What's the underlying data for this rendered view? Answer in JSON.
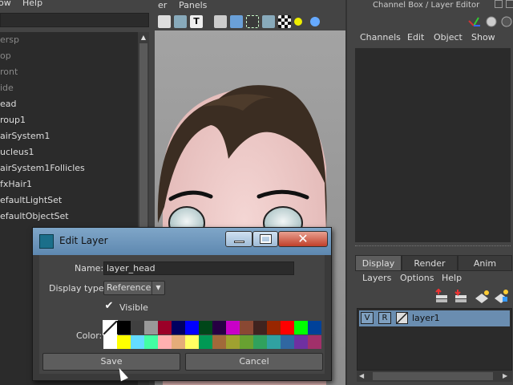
{
  "outliner": {
    "menu": [
      "ow",
      "Help"
    ],
    "items": [
      {
        "label": "ersp",
        "dim": true
      },
      {
        "label": "op",
        "dim": true
      },
      {
        "label": "ront",
        "dim": true
      },
      {
        "label": "ide",
        "dim": true
      },
      {
        "label": "ead",
        "dim": false
      },
      {
        "label": "roup1",
        "dim": false
      },
      {
        "label": "airSystem1",
        "dim": false
      },
      {
        "label": "ucleus1",
        "dim": false
      },
      {
        "label": "airSystem1Follicles",
        "dim": false
      },
      {
        "label": "fxHair1",
        "dim": false
      },
      {
        "label": "efaultLightSet",
        "dim": false
      },
      {
        "label": "efaultObjectSet",
        "dim": false
      }
    ]
  },
  "viewport": {
    "menu": [
      "er",
      "Panels"
    ]
  },
  "channel_box": {
    "title": "Channel Box / Layer Editor",
    "menu": [
      "Channels",
      "Edit",
      "Object",
      "Show"
    ],
    "tabs": [
      "Display",
      "Render",
      "Anim"
    ],
    "active_tab": "Display",
    "layer_menu": [
      "Layers",
      "Options",
      "Help"
    ],
    "layers": [
      {
        "visible_btn": "V",
        "ref_btn": "R",
        "name": "layer1"
      }
    ]
  },
  "dialog": {
    "title": "Edit Layer",
    "name_label": "Name:",
    "name_value": "layer_head",
    "display_type_label": "Display type:",
    "display_type_value": "Reference",
    "visible_label": "Visible",
    "visible_checked": true,
    "color_label": "Color:",
    "save_label": "Save",
    "cancel_label": "Cancel",
    "palette": [
      "#ffffff",
      "#000000",
      "#404040",
      "#999999",
      "#9b0028",
      "#000060",
      "#0000ff",
      "#004619",
      "#260043",
      "#c800c8",
      "#8a4833",
      "#3f231f",
      "#992600",
      "#ff0000",
      "#00ff00",
      "#004199",
      "#ffffff",
      "#ffff00",
      "#64dcff",
      "#43ffa3",
      "#ffb0b0",
      "#e4ac79",
      "#ffff62",
      "#009954",
      "#a1693a",
      "#9fa130",
      "#68a131",
      "#30a15d",
      "#30a1a1",
      "#3067a1",
      "#6f30a1",
      "#a1306a"
    ]
  }
}
